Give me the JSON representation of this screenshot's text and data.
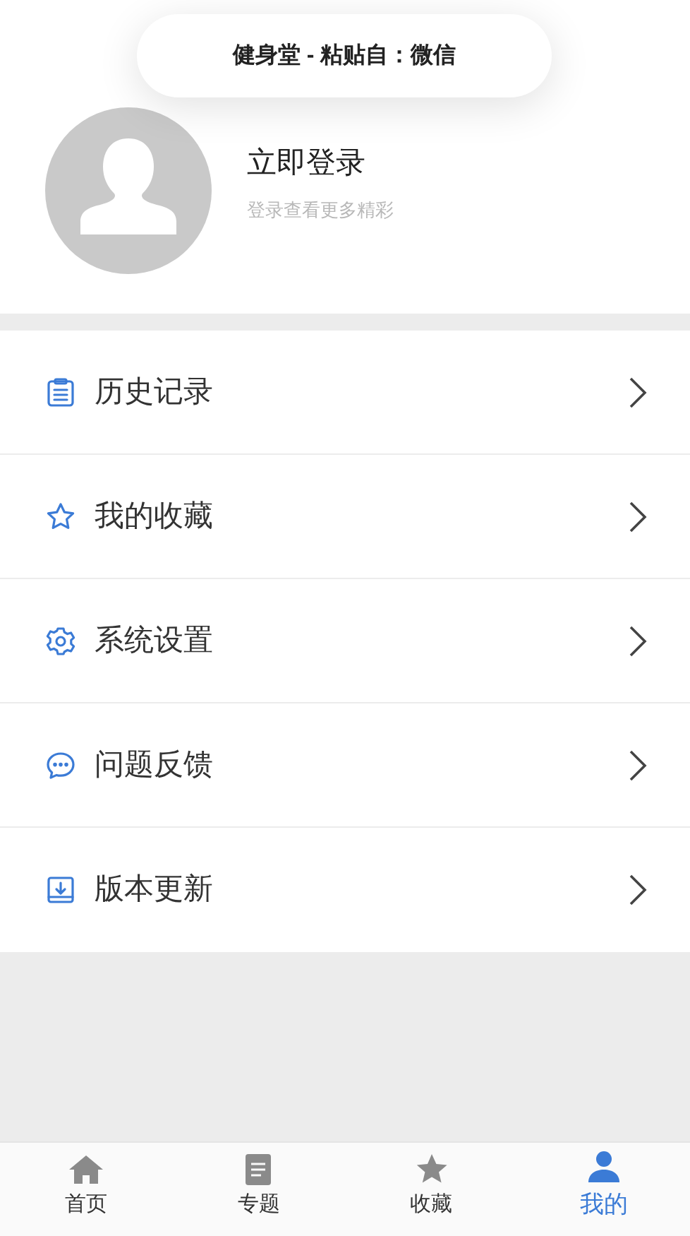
{
  "toast": {
    "text": "健身堂 - 粘贴自：微信"
  },
  "profile": {
    "title": "立即登录",
    "subtitle": "登录查看更多精彩"
  },
  "menu": [
    {
      "kind": "history",
      "label": "历史记录"
    },
    {
      "kind": "favorites",
      "label": "我的收藏"
    },
    {
      "kind": "settings",
      "label": "系统设置"
    },
    {
      "kind": "feedback",
      "label": "问题反馈"
    },
    {
      "kind": "update",
      "label": "版本更新"
    }
  ],
  "tabs": [
    {
      "kind": "home",
      "label": "首页",
      "selected": false
    },
    {
      "kind": "topics",
      "label": "专题",
      "selected": false
    },
    {
      "kind": "favorites",
      "label": "收藏",
      "selected": false
    },
    {
      "kind": "mine",
      "label": "我的",
      "selected": true
    }
  ]
}
